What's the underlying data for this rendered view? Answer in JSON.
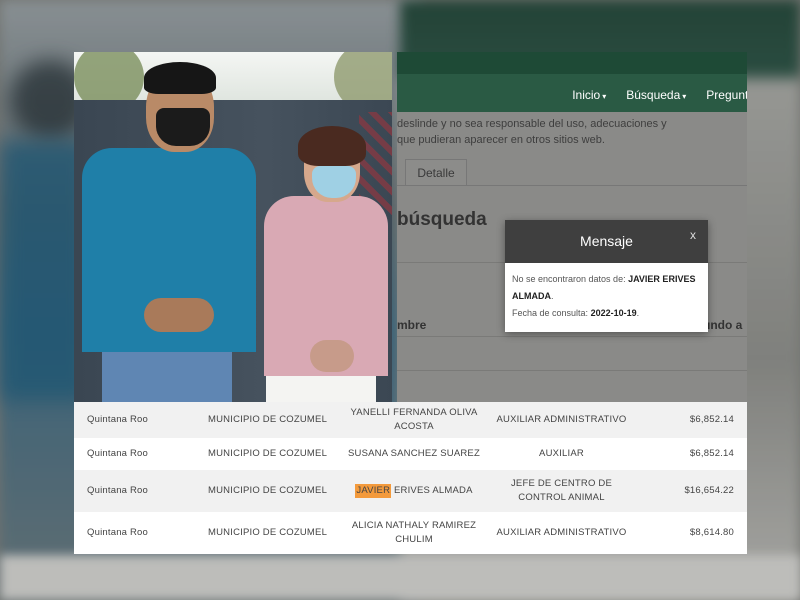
{
  "nav": {
    "items": [
      "Inicio",
      "Búsqueda",
      "Pregunta"
    ]
  },
  "disclaimer": {
    "line1": "deslinde y no sea responsable del uso, adecuaciones y",
    "line2": "que pudieran aparecer en otros sitios web."
  },
  "tabs": {
    "detail": "Detalle"
  },
  "page": {
    "title": "búsqueda",
    "col_name": "mbre",
    "col_assigned": "undo a"
  },
  "modal": {
    "title": "Mensaje",
    "close": "x",
    "msg_prefix": "No se encontraron datos de:",
    "name_line1": "JAVIER ERIVES",
    "name_line2": "ALMADA",
    "date_label": "Fecha de consulta:",
    "date_value": "2022-10-19"
  },
  "table": {
    "rows": [
      {
        "state": "Quintana Roo",
        "entity": "MUNICIPIO DE COZUMEL",
        "name_a": "YANELLI FERNANDA OLIVA",
        "name_b": "ACOSTA",
        "role_a": "AUXILIAR ADMINISTRATIVO",
        "role_b": "",
        "salary": "$6,852.14"
      },
      {
        "state": "Quintana Roo",
        "entity": "MUNICIPIO DE COZUMEL",
        "name_a": "SUSANA SANCHEZ SUAREZ",
        "name_b": "",
        "role_a": "AUXILIAR",
        "role_b": "",
        "salary": "$6,852.14"
      },
      {
        "state": "Quintana Roo",
        "entity": "MUNICIPIO DE COZUMEL",
        "name_hl": "JAVIER",
        "name_rest": " ERIVES ALMADA",
        "role_a": "JEFE DE CENTRO DE",
        "role_b": "CONTROL ANIMAL",
        "salary": "$16,654.22"
      },
      {
        "state": "Quintana Roo",
        "entity": "MUNICIPIO DE COZUMEL",
        "name_a": "ALICIA NATHALY RAMIREZ",
        "name_b": "CHULIM",
        "role_a": "AUXILIAR ADMINISTRATIVO",
        "role_b": "",
        "salary": "$8,614.80"
      }
    ]
  },
  "colors": {
    "navbar": "#2a5a44",
    "modal_header": "#3f3f3f",
    "highlight": "#f39a3c",
    "shirt_man": "#1f7fa8",
    "blouse_woman": "#d9a9b4"
  }
}
